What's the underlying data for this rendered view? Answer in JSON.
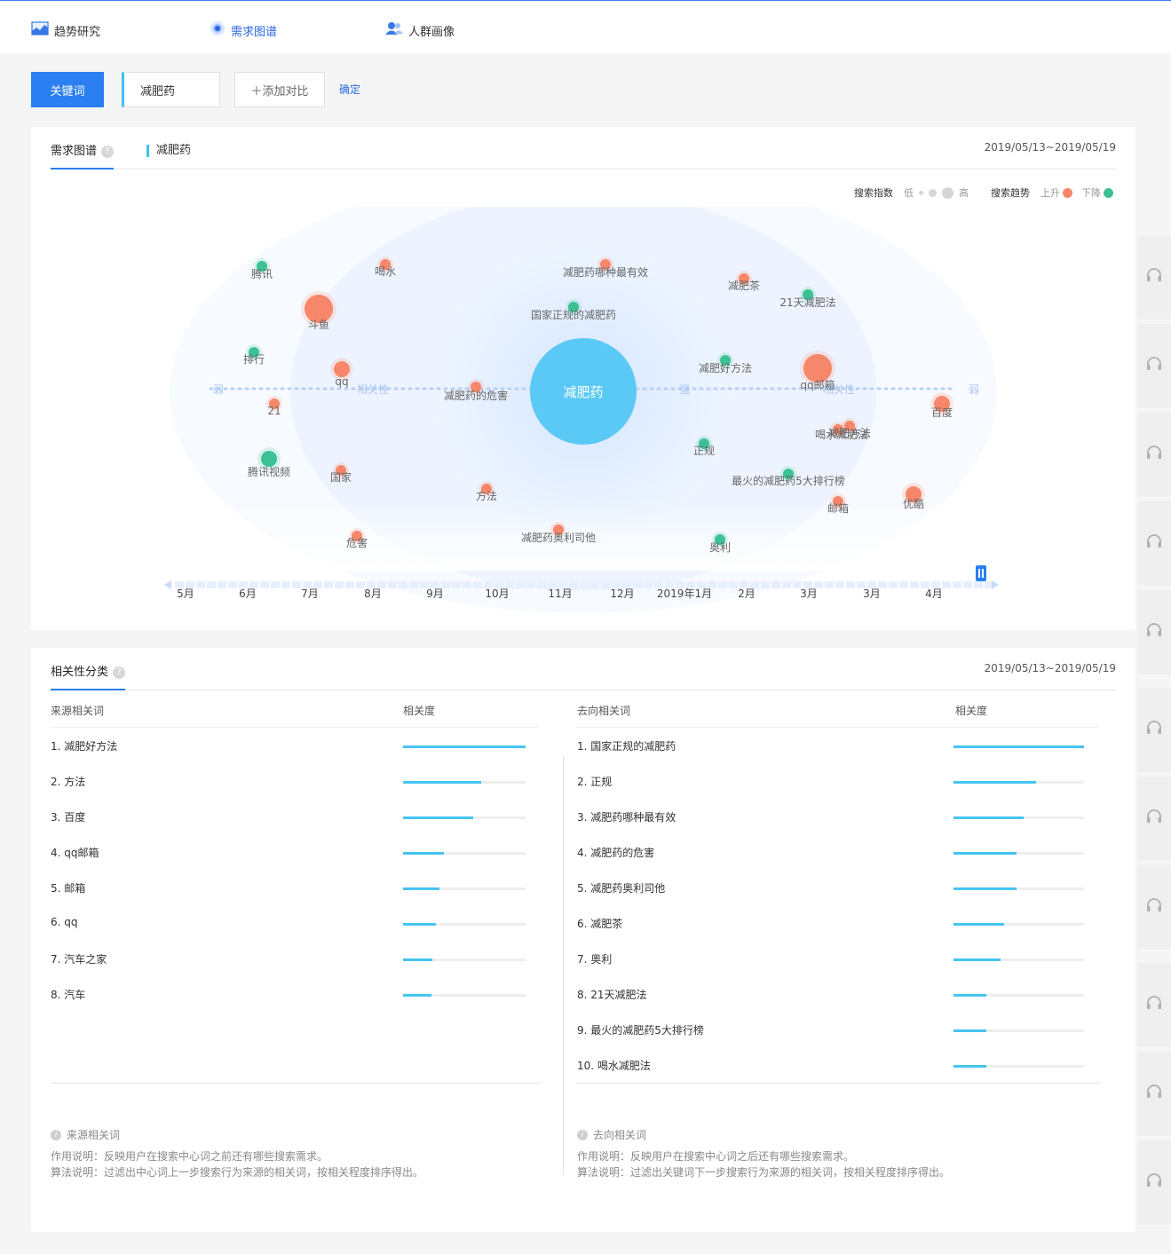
{
  "nav": {
    "tabs": [
      {
        "label": "趋势研究",
        "icon": "trend-chart-icon",
        "active": false
      },
      {
        "label": "需求图谱",
        "icon": "target-radar-icon",
        "active": true
      },
      {
        "label": "人群画像",
        "icon": "people-icon",
        "active": false
      }
    ]
  },
  "controls": {
    "keyword_button": "关键词",
    "keyword_value": "减肥药",
    "add_compare": "＋添加对比",
    "confirm": "确定"
  },
  "map_panel": {
    "title": "需求图谱",
    "keyword": "减肥药",
    "date_range": "2019/05/13~2019/05/19",
    "legend": {
      "search_index_label": "搜索指数",
      "low": "低",
      "high": "高",
      "trend_label": "搜索趋势",
      "up": "上升",
      "down": "下降",
      "up_color": "#f7876a",
      "down_color": "#3cc195"
    }
  },
  "chart_data": {
    "type": "bubble",
    "center": "减肥药",
    "axis_labels": {
      "weak": "弱",
      "strong": "强",
      "relevance": "相关性"
    },
    "colors": {
      "up": "#f7876a",
      "down": "#3cc195"
    },
    "nodes": [
      {
        "label": "腾讯",
        "trend": "down",
        "size": "small",
        "side": "left"
      },
      {
        "label": "喝水",
        "trend": "up",
        "size": "small",
        "side": "left"
      },
      {
        "label": "斗鱼",
        "trend": "up",
        "size": "large",
        "side": "left"
      },
      {
        "label": "排行",
        "trend": "down",
        "size": "small",
        "side": "left"
      },
      {
        "label": "qq",
        "trend": "up",
        "size": "medium",
        "side": "left"
      },
      {
        "label": "21",
        "trend": "up",
        "size": "small",
        "side": "left"
      },
      {
        "label": "腾讯视频",
        "trend": "down",
        "size": "medium",
        "side": "left"
      },
      {
        "label": "国家",
        "trend": "up",
        "size": "small",
        "side": "left"
      },
      {
        "label": "危害",
        "trend": "up",
        "size": "small",
        "side": "left"
      },
      {
        "label": "减肥药的危害",
        "trend": "up",
        "size": "small",
        "side": "left"
      },
      {
        "label": "方法",
        "trend": "up",
        "size": "small",
        "side": "left"
      },
      {
        "label": "减肥药奥利司他",
        "trend": "up",
        "size": "small",
        "side": "left"
      },
      {
        "label": "减肥药哪种最有效",
        "trend": "up",
        "size": "small",
        "side": "right"
      },
      {
        "label": "国家正规的减肥药",
        "trend": "down",
        "size": "small",
        "side": "right"
      },
      {
        "label": "减肥茶",
        "trend": "up",
        "size": "small",
        "side": "right"
      },
      {
        "label": "21天减肥法",
        "trend": "down",
        "size": "small",
        "side": "right"
      },
      {
        "label": "减肥好方法",
        "trend": "down",
        "size": "small",
        "side": "right"
      },
      {
        "label": "qq邮箱",
        "trend": "up",
        "size": "large",
        "side": "right"
      },
      {
        "label": "百度",
        "trend": "up",
        "size": "medium",
        "side": "right"
      },
      {
        "label": "正规",
        "trend": "down",
        "size": "small",
        "side": "right"
      },
      {
        "label": "喝水减肥法",
        "trend": "up",
        "size": "small",
        "side": "right"
      },
      {
        "label": "减肥方法",
        "trend": "up",
        "size": "small",
        "side": "right"
      },
      {
        "label": "最火的减肥药5大排行榜",
        "trend": "down",
        "size": "small",
        "side": "right"
      },
      {
        "label": "邮箱",
        "trend": "up",
        "size": "small",
        "side": "right"
      },
      {
        "label": "优酷",
        "trend": "up",
        "size": "medium",
        "side": "right"
      },
      {
        "label": "奥利",
        "trend": "down",
        "size": "small",
        "side": "right"
      }
    ],
    "timeline": [
      "5月",
      "6月",
      "7月",
      "8月",
      "9月",
      "10月",
      "11月",
      "12月",
      "2019年1月",
      "2月",
      "3月",
      "3月",
      "4月"
    ]
  },
  "category_panel": {
    "title": "相关性分类",
    "date_range": "2019/05/13~2019/05/19",
    "source": {
      "header": "来源相关词",
      "score_header": "相关度",
      "items": [
        {
          "rank": "1.",
          "label": "减肥好方法",
          "score": 1.0
        },
        {
          "rank": "2.",
          "label": "方法",
          "score": 0.64
        },
        {
          "rank": "3.",
          "label": "百度",
          "score": 0.57
        },
        {
          "rank": "4.",
          "label": "qq邮箱",
          "score": 0.33
        },
        {
          "rank": "5.",
          "label": "邮箱",
          "score": 0.3
        },
        {
          "rank": "6.",
          "label": "qq",
          "score": 0.27
        },
        {
          "rank": "7.",
          "label": "汽车之家",
          "score": 0.24
        },
        {
          "rank": "8.",
          "label": "汽车",
          "score": 0.23
        }
      ],
      "note_title": "来源相关词",
      "note_lines": [
        "作用说明：反映用户在搜索中心词之前还有哪些搜索需求。",
        "算法说明：过滤出中心词上一步搜索行为来源的相关词，按相关程度排序得出。"
      ]
    },
    "target": {
      "header": "去向相关词",
      "score_header": "相关度",
      "items": [
        {
          "rank": "1.",
          "label": "国家正规的减肥药",
          "score": 1.0
        },
        {
          "rank": "2.",
          "label": "正规",
          "score": 0.63
        },
        {
          "rank": "3.",
          "label": "减肥药哪种最有效",
          "score": 0.54
        },
        {
          "rank": "4.",
          "label": "减肥药的危害",
          "score": 0.48
        },
        {
          "rank": "5.",
          "label": "减肥药奥利司他",
          "score": 0.48
        },
        {
          "rank": "6.",
          "label": "减肥茶",
          "score": 0.39
        },
        {
          "rank": "7.",
          "label": "奥利",
          "score": 0.36
        },
        {
          "rank": "8.",
          "label": "21天减肥法",
          "score": 0.25
        },
        {
          "rank": "9.",
          "label": "最火的减肥药5大排行榜",
          "score": 0.25
        },
        {
          "rank": "10.",
          "label": "喝水减肥法",
          "score": 0.25
        }
      ],
      "note_title": "去向相关词",
      "note_lines": [
        "作用说明：反映用户在搜索中心词之后还有哪些搜索需求。",
        "算法说明：过滤出关键词下一步搜索行为来源的相关词，按相关程度排序得出。"
      ]
    }
  }
}
